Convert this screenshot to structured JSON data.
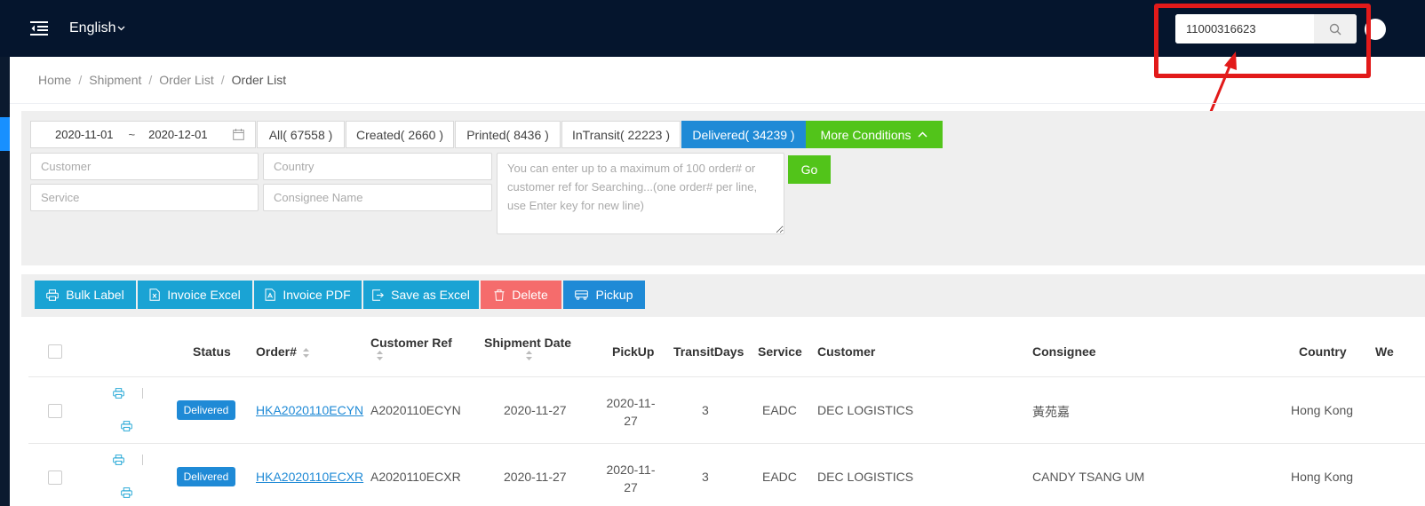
{
  "header": {
    "language": "English",
    "search_value": "11000316623",
    "colors": {
      "bar": "#05152d",
      "annotation": "#e21a1a"
    }
  },
  "breadcrumb": [
    "Home",
    "Shipment",
    "Order List",
    "Order List"
  ],
  "filters": {
    "date_from": "2020-11-01",
    "date_sep": "~",
    "date_to": "2020-12-01",
    "status_tabs": [
      {
        "label": "All( 67558 )",
        "active": false
      },
      {
        "label": "Created( 2660 )",
        "active": false
      },
      {
        "label": "Printed( 8436 )",
        "active": false
      },
      {
        "label": "InTransit( 22223 )",
        "active": false
      },
      {
        "label": "Delivered( 34239 )",
        "active": true
      }
    ],
    "more_conditions": "More Conditions",
    "customer_placeholder": "Customer",
    "country_placeholder": "Country",
    "service_placeholder": "Service",
    "consignee_placeholder": "Consignee Name",
    "orders_placeholder": "You can enter up to a maximum of 100 order# or customer ref for Searching...(one order# per line, use Enter key for new line)",
    "go": "Go"
  },
  "actions": {
    "bulk_label": "Bulk Label",
    "invoice_excel": "Invoice Excel",
    "invoice_pdf": "Invoice PDF",
    "save_as_excel": "Save as Excel",
    "delete": "Delete",
    "pickup": "Pickup"
  },
  "table": {
    "columns": {
      "status": "Status",
      "order": "Order#",
      "customer_ref": "Customer Ref",
      "shipment_date": "Shipment Date",
      "pickup": "PickUp",
      "transit_days": "TransitDays",
      "service": "Service",
      "customer": "Customer",
      "consignee": "Consignee",
      "country": "Country",
      "weight": "We"
    },
    "rows": [
      {
        "status": "Delivered",
        "order": "HKA2020110ECYN",
        "customer_ref": "A2020110ECYN",
        "shipment_date": "2020-11-27",
        "pickup_line1": "2020-11-",
        "pickup_line2": "27",
        "transit_days": "3",
        "service": "EADC",
        "customer": "DEC LOGISTICS",
        "consignee": "黃苑嘉",
        "country": "Hong Kong"
      },
      {
        "status": "Delivered",
        "order": "HKA2020110ECXR",
        "customer_ref": "A2020110ECXR",
        "shipment_date": "2020-11-27",
        "pickup_line1": "2020-11-",
        "pickup_line2": "27",
        "transit_days": "3",
        "service": "EADC",
        "customer": "DEC LOGISTICS",
        "consignee": "CANDY TSANG UM",
        "country": "Hong Kong"
      }
    ]
  }
}
